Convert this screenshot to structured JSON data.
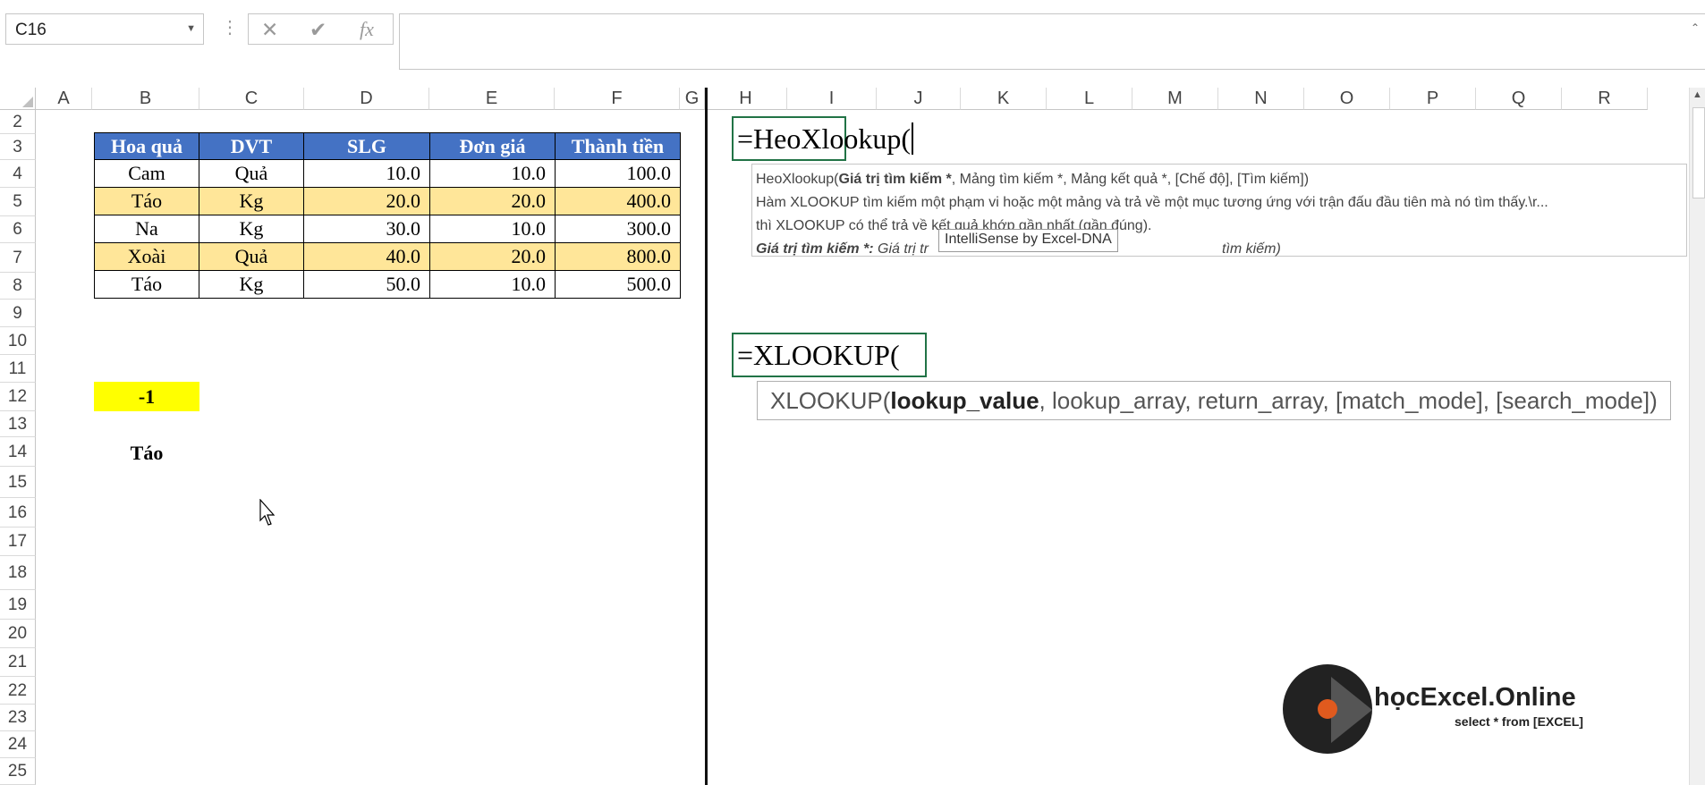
{
  "formula_bar": {
    "name_box": "C16",
    "cancel_icon": "✕",
    "enter_icon": "✔",
    "fx_label": "fx",
    "formula_value": ""
  },
  "columns": [
    "A",
    "B",
    "C",
    "D",
    "E",
    "F",
    "G",
    "H",
    "I",
    "J",
    "K",
    "L",
    "M",
    "N",
    "O",
    "P",
    "Q",
    "R"
  ],
  "rows": [
    "2",
    "3",
    "4",
    "5",
    "6",
    "7",
    "8",
    "9",
    "10",
    "11",
    "12",
    "13",
    "14",
    "15",
    "16",
    "17",
    "18",
    "19",
    "20",
    "21",
    "22",
    "23",
    "24",
    "25"
  ],
  "table": {
    "headers": [
      "Hoa quả",
      "DVT",
      "SLG",
      "Đơn giá",
      "Thành tiền"
    ],
    "rows": [
      [
        "Cam",
        "Quả",
        "10.0",
        "10.0",
        "100.0"
      ],
      [
        "Táo",
        "Kg",
        "20.0",
        "20.0",
        "400.0"
      ],
      [
        "Na",
        "Kg",
        "30.0",
        "10.0",
        "300.0"
      ],
      [
        "Xoài",
        "Quả",
        "40.0",
        "20.0",
        "800.0"
      ],
      [
        "Táo",
        "Kg",
        "50.0",
        "10.0",
        "500.0"
      ]
    ]
  },
  "cells": {
    "b12": "-1",
    "b14": "Táo"
  },
  "heo_formula": {
    "edit_text": "=HeoXlookup(",
    "tip_sig_name": "HeoXlookup(",
    "tip_sig_bold": "Giá trị tìm kiếm *",
    "tip_sig_rest": ", Mảng tìm kiếm *, Mảng kết quả *, [Chế độ], [Tìm kiếm])",
    "tip_desc1": "Hàm XLOOKUP tìm kiếm một phạm vi hoặc một mảng và trả về một mục tương ứng với trận đấu đầu tiên mà nó tìm thấy.\\r...",
    "tip_desc2": " thì XLOOKUP có thể trả về kết quả khớp gần nhất (gần đúng).",
    "tip_param_bold": "Giá trị tìm kiếm *:",
    "tip_param_italic": " Giá trị tr",
    "tip_param_tail": "tìm kiếm)",
    "intellisense_badge": "IntelliSense by Excel-DNA"
  },
  "xlookup_formula": {
    "edit_text": "=XLOOKUP(",
    "tip_name": "XLOOKUP(",
    "tip_bold": "lookup_value",
    "tip_rest": ", lookup_array, return_array, [match_mode], [search_mode])"
  },
  "logo": {
    "brand": "họcExcel.Online",
    "tagline": "select * from [EXCEL]"
  }
}
